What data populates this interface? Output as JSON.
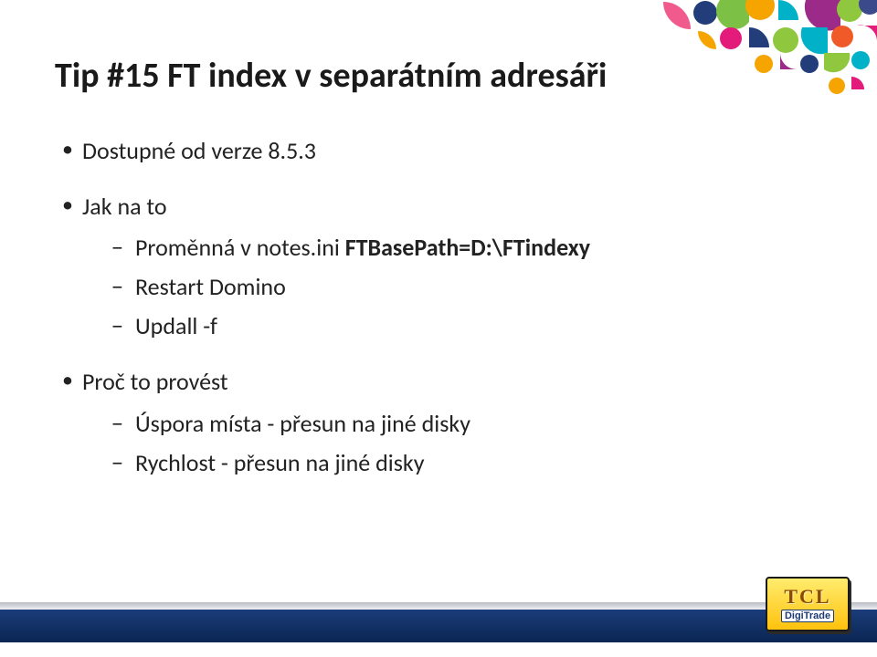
{
  "title": "Tip #15 FT index v separátním adresáři",
  "bullets": {
    "b1": {
      "label": "Dostupné od verze 8.5.3"
    },
    "b2": {
      "label": "Jak na to",
      "sub1_prefix": "Proměnná v notes.ini ",
      "sub1_bold": "FTBasePath=D:\\FTindexy",
      "sub2": "Restart Domino",
      "sub3": "Updall -f"
    },
    "b3": {
      "label": "Proč to provést",
      "sub1": "Úspora místa - přesun na jiné disky",
      "sub2": "Rychlost - přesun na jiné disky"
    }
  },
  "logo": {
    "top": "TCL",
    "bottom": "DigiTrade"
  }
}
